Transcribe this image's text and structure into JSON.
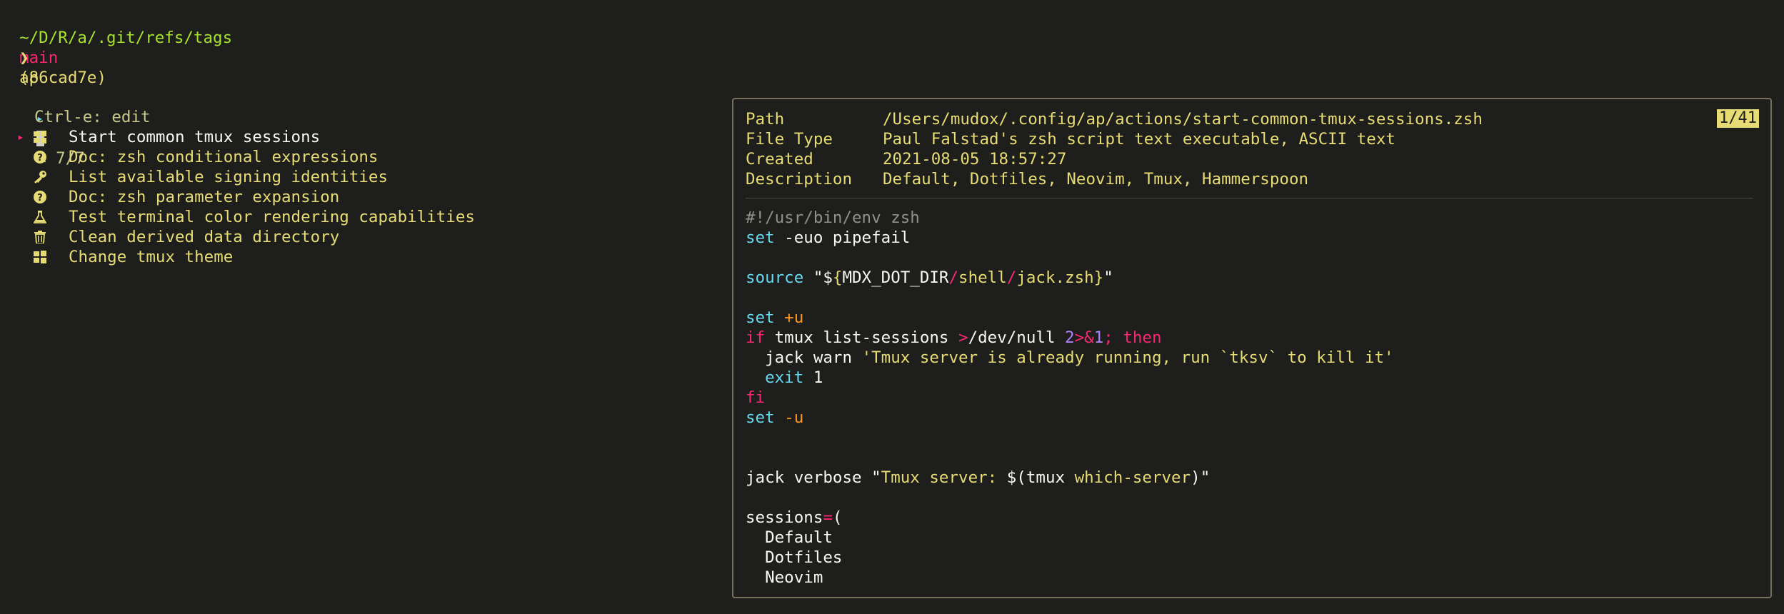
{
  "prompt": {
    "path": "~/D/R/a/.git/refs/tags",
    "branch": "main",
    "commit": "(86cad7e)",
    "chevron": "❯",
    "command": "ap"
  },
  "picker": {
    "pointer": "▸",
    "count": "< 7/7",
    "hint": "Ctrl-e: edit",
    "items": [
      {
        "label": "Start common tmux sessions",
        "icon": "windows-icon"
      },
      {
        "label": "Doc: zsh conditional expressions",
        "icon": "question-circle-icon"
      },
      {
        "label": "List available signing identities",
        "icon": "key-icon"
      },
      {
        "label": "Doc: zsh parameter expansion",
        "icon": "question-circle-icon"
      },
      {
        "label": "Test terminal color rendering capabilities",
        "icon": "flask-icon"
      },
      {
        "label": "Clean derived data directory",
        "icon": "trash-icon"
      },
      {
        "label": "Change tmux theme",
        "icon": "windows-icon"
      }
    ],
    "selected_index": 0
  },
  "preview": {
    "position": "1/41",
    "meta": [
      {
        "key": "Path",
        "value": "/Users/mudox/.config/ap/actions/start-common-tmux-sessions.zsh"
      },
      {
        "key": "File Type",
        "value": "Paul Falstad's zsh script text executable, ASCII text"
      },
      {
        "key": "Created",
        "value": "2021-08-05 18:57:27"
      },
      {
        "key": "Description",
        "value": "Default, Dotfiles, Neovim, Tmux, Hammerspoon"
      }
    ],
    "code": {
      "shebang": "#!/usr/bin/env zsh",
      "set1_kw": "set",
      "set1_rest": " -euo pipefail",
      "source_kw": "source",
      "source_q1": " \"$",
      "source_brace_open": "{",
      "source_var": "MDX_DOT_DIR",
      "source_slash1": "/",
      "source_shell": "shell",
      "source_slash2": "/",
      "source_file": "jack.zsh",
      "source_brace_close": "}",
      "source_q2": "\"",
      "set2_kw": "set",
      "set2_flag": " +u",
      "if_kw": "if",
      "if_cmd": " tmux list-sessions ",
      "if_redirect": ">",
      "if_null": "/dev/null ",
      "if_two": "2",
      "if_amp": ">&",
      "if_one": "1",
      "if_semi": "; ",
      "then_kw": "then",
      "warn_cmd": "  jack warn ",
      "warn_msg": "'Tmux server is already running, run `tksv` to kill it'",
      "exit_indent": "  ",
      "exit_kw": "exit",
      "exit_code": " 1",
      "fi_kw": "fi",
      "set3_kw": "set",
      "set3_flag": " -u",
      "verbose_cmd": "jack verbose ",
      "verbose_q1": "\"",
      "verbose_str": "Tmux server: ",
      "verbose_sub_open": "$(",
      "verbose_tmux": "tmux",
      "verbose_which": " which-server",
      "verbose_sub_close": ")",
      "verbose_q2": "\"",
      "sessions_name": "sessions",
      "sessions_eq": "=",
      "sessions_paren": "(",
      "session_items": [
        "  Default",
        "  Dotfiles",
        "  Neovim"
      ]
    }
  },
  "colors": {
    "background": "#1e1f1c",
    "accent_pink": "#f92672",
    "accent_yellow": "#e6db74",
    "accent_cyan": "#66d9ef",
    "accent_orange": "#fd971f",
    "accent_purple": "#ae81ff",
    "border": "#75715e"
  }
}
